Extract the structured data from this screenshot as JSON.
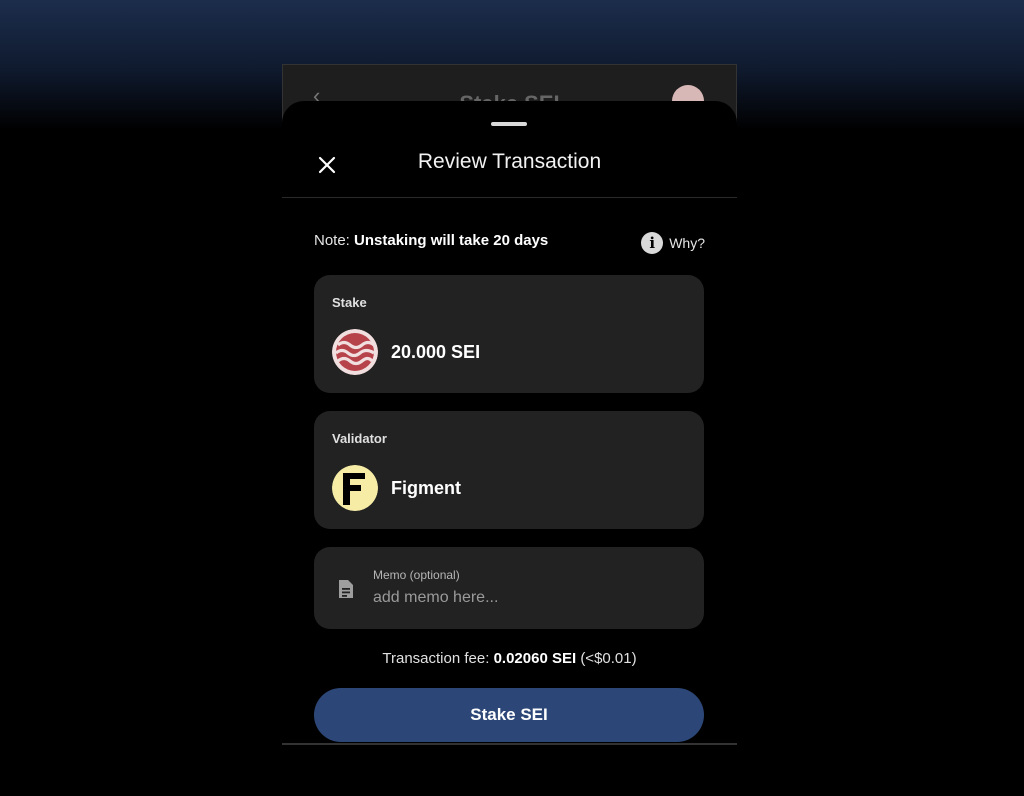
{
  "background": {
    "title": "Stake SEI",
    "back_glyph": "‹"
  },
  "sheet": {
    "title": "Review Transaction",
    "close_icon": "close-icon",
    "note_prefix": "Note:",
    "note_text": "Unstaking will take 20 days",
    "why_label": "Why?",
    "stake_card": {
      "label": "Stake",
      "value": "20.000 SEI",
      "icon": "sei-token-icon"
    },
    "validator_card": {
      "label": "Validator",
      "value": "Figment",
      "icon": "figment-logo"
    },
    "memo": {
      "label": "Memo (optional)",
      "placeholder": "add memo here...",
      "value": ""
    },
    "fee": {
      "prefix": "Transaction fee:",
      "amount": "0.02060 SEI",
      "fiat": "(<$0.01)"
    },
    "submit_label": "Stake SEI"
  },
  "colors": {
    "accent": "#2c4777",
    "card": "#222222",
    "sei_red": "#b6424a",
    "sei_cream": "#f1dede",
    "figment_yellow": "#f6eca6"
  }
}
